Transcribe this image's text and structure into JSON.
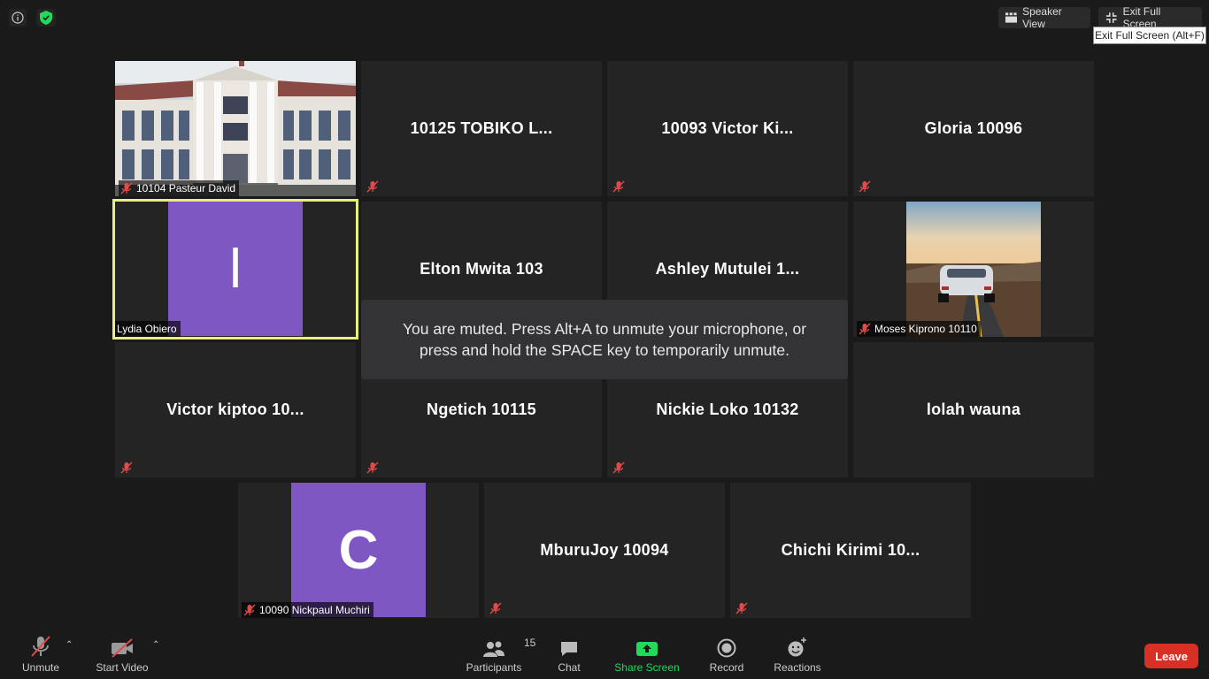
{
  "top": {
    "speaker_view": "Speaker View",
    "exit_full_screen": "Exit Full Screen",
    "tooltip": "Exit Full Screen (Alt+F)"
  },
  "tiles": [
    {
      "name": "10104 Pasteur David"
    },
    {
      "name": "10125  TOBIKO L..."
    },
    {
      "name": "10093 Victor Ki..."
    },
    {
      "name": "Gloria 10096"
    },
    {
      "name": "Lydia Obiero",
      "initial": "l"
    },
    {
      "name": "Elton Mwita 103"
    },
    {
      "name": "Ashley Mutulei 1..."
    },
    {
      "name": "Moses Kiprono 10110"
    },
    {
      "name": "Victor kiptoo 10..."
    },
    {
      "name": "Ngetich 10115"
    },
    {
      "name": "Nickie Loko 10132"
    },
    {
      "name": "lolah wauna"
    },
    {
      "name": "10090 Nickpaul Muchiri",
      "initial": "C"
    },
    {
      "name": "MburuJoy 10094"
    },
    {
      "name": "Chichi Kirimi 10..."
    }
  ],
  "muted_message": {
    "line1": "You are muted. Press Alt+A to unmute your microphone, or",
    "line2": "press and hold the SPACE key to temporarily unmute."
  },
  "toolbar": {
    "unmute": "Unmute",
    "start_video": "Start Video",
    "participants": "Participants",
    "participants_count": "15",
    "chat": "Chat",
    "share_screen": "Share Screen",
    "record": "Record",
    "reactions": "Reactions",
    "leave": "Leave"
  },
  "colors": {
    "background": "#1a1a1a",
    "tile": "#242424",
    "avatar": "#7e57c2",
    "active_border": "#e8f07a",
    "share_green": "#23d959",
    "leave_red": "#d93025",
    "mute_red": "#e04a4a"
  }
}
